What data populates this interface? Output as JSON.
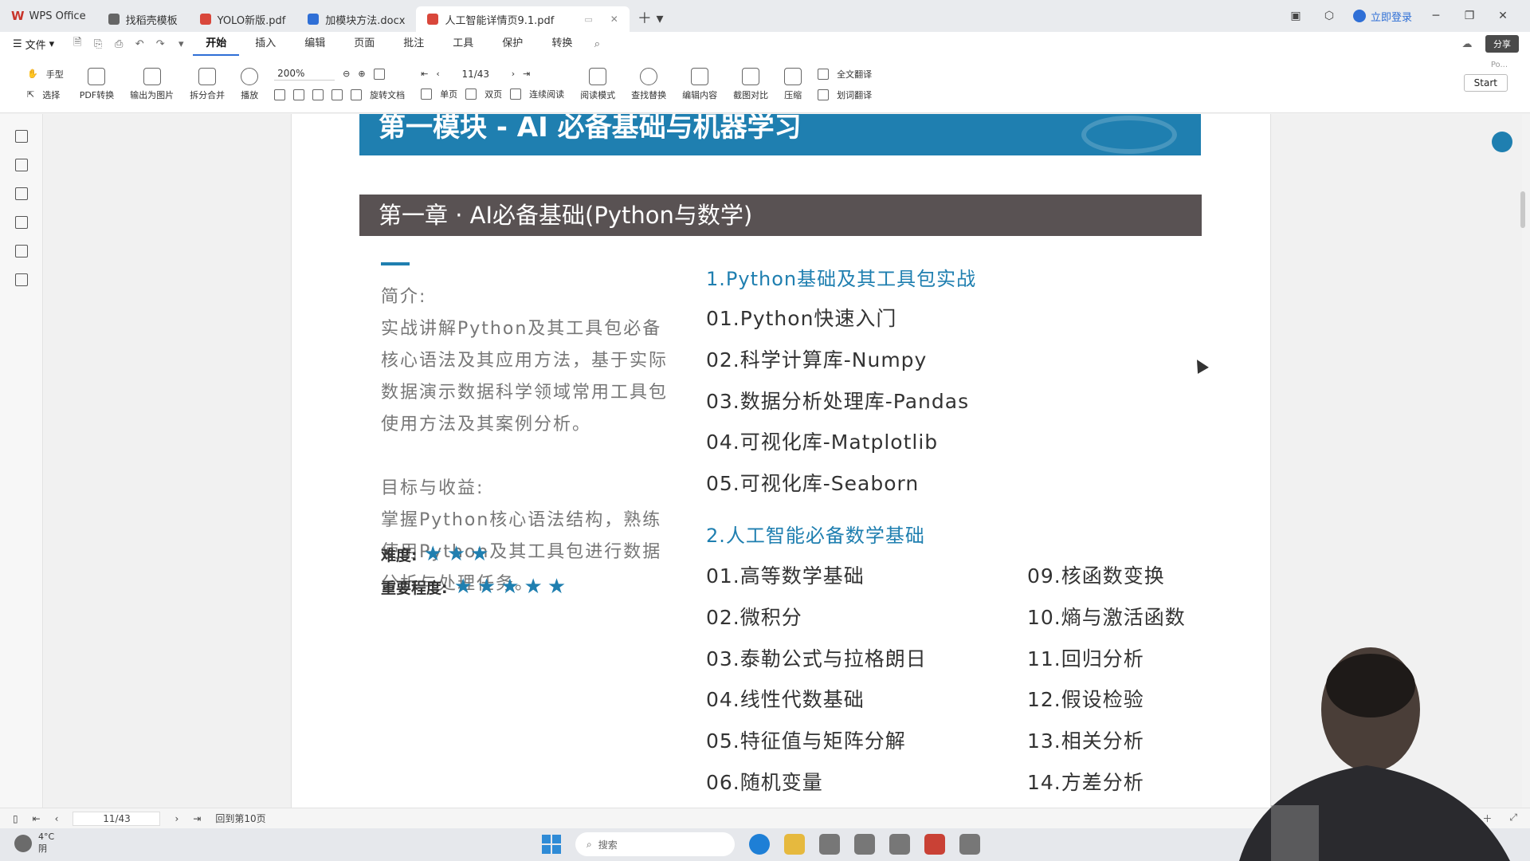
{
  "tabs": {
    "app": "WPS Office",
    "items": [
      {
        "label": "找稻壳模板",
        "type": "grey"
      },
      {
        "label": "YOLO新版.pdf",
        "type": "pdf"
      },
      {
        "label": "加模块方法.docx",
        "type": "doc"
      },
      {
        "label": "人工智能详情页9.1.pdf",
        "type": "pdf",
        "active": true
      }
    ],
    "login": "立即登录"
  },
  "menu": {
    "file": "文件",
    "items": [
      "开始",
      "插入",
      "编辑",
      "页面",
      "批注",
      "工具",
      "保护",
      "转换"
    ],
    "active": "开始",
    "share": "分享"
  },
  "ribbon": {
    "hand": "手型",
    "select": "选择",
    "pdf_convert": "PDF转换",
    "export_image": "输出为图片",
    "split_merge": "拆分合并",
    "play": "播放",
    "zoom": "200%",
    "page": "11/43",
    "rotate": "旋转文档",
    "single": "单页",
    "double": "双页",
    "continuous": "连续阅读",
    "read_mode": "阅读模式",
    "find_replace": "查找替换",
    "edit_content": "编辑内容",
    "compare": "截图对比",
    "compress": "压缩",
    "full_translate": "全文翻译",
    "word_translate": "划词翻译",
    "start": "Start",
    "right_small": "Po..."
  },
  "document": {
    "module_title": "第一模块 - AI 必备基础与机器学习",
    "chapter_title": "第一章 · AI必备基础(Python与数学)",
    "intro_heading": "简介:",
    "intro_body": "实战讲解Python及其工具包必备核心语法及其应用方法，基于实际数据演示数据科学领域常用工具包使用方法及其案例分析。",
    "goal_heading": "目标与收益:",
    "goal_body": "掌握Python核心语法结构，熟练使用Python及其工具包进行数据分析与处理任务。",
    "difficulty_label": "难度:",
    "difficulty_stars": 3,
    "difficulty_stars_text": "★★★",
    "importance_label": "重要程度:",
    "importance_stars": 5,
    "importance_stars_text": "★★★★★",
    "section1_title": "1.Python基础及其工具包实战",
    "section1_items": [
      "01.Python快速入门",
      "02.科学计算库-Numpy",
      "03.数据分析处理库-Pandas",
      "04.可视化库-Matplotlib",
      "05.可视化库-Seaborn"
    ],
    "section2_title": "2.人工智能必备数学基础",
    "section2_left": [
      "01.高等数学基础",
      "02.微积分",
      "03.泰勒公式与拉格朗日",
      "04.线性代数基础",
      "05.特征值与矩阵分解",
      "06.随机变量"
    ],
    "section2_right": [
      "09.核函数变换",
      "10.熵与激活函数",
      "11.回归分析",
      "12.假设检验",
      "13.相关分析",
      "14.方差分析"
    ]
  },
  "status": {
    "page": "11/43",
    "back_to": "回到第10页"
  },
  "taskbar": {
    "temp": "4°C",
    "weather": "阴",
    "search": "搜索"
  },
  "colors": {
    "accent_blue": "#1f7fb0",
    "chapter_bar": "#595253"
  }
}
